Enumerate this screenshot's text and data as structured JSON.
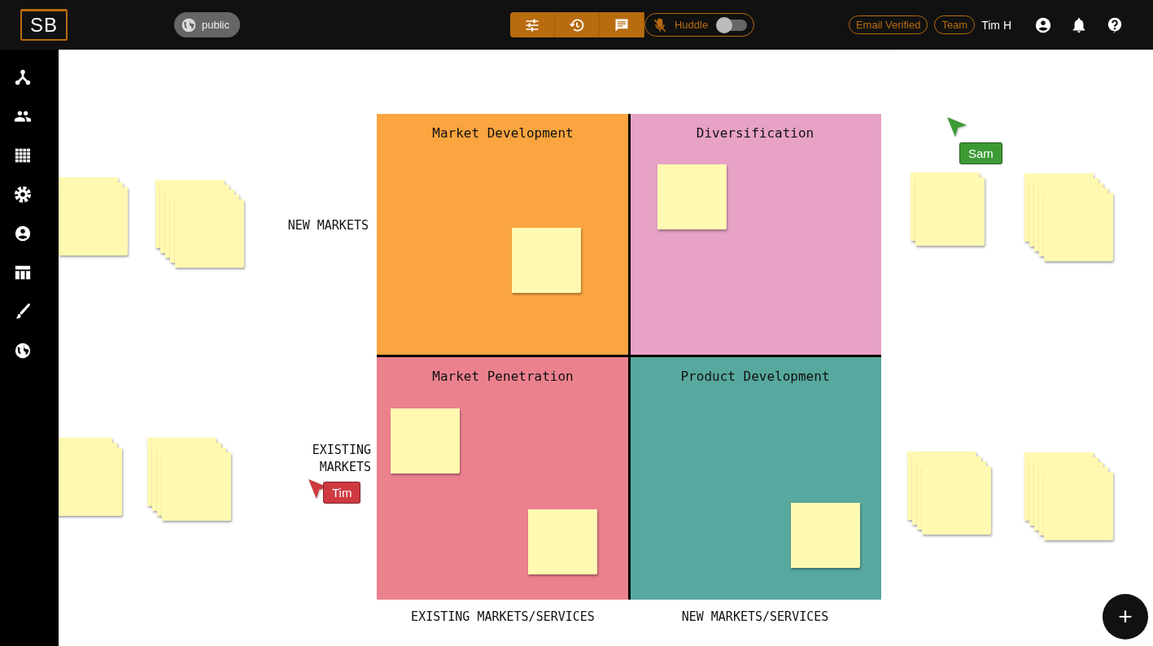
{
  "topbar": {
    "logo": "SB",
    "visibility": "public",
    "huddle": {
      "label": "Huddle",
      "on": false
    },
    "badges": [
      "Email Verified",
      "Team"
    ],
    "user": "Tim H"
  },
  "board": {
    "quadrants": [
      {
        "label": "Market Development",
        "color": "#fba540"
      },
      {
        "label": "Diversification",
        "color": "#e8a2c6"
      },
      {
        "label": "Market Penetration",
        "color": "#ec818e"
      },
      {
        "label": "Product Development",
        "color": "#57a89e"
      }
    ],
    "y_labels": [
      "NEW MARKETS",
      "EXISTING MARKETS"
    ],
    "x_labels": [
      "EXISTING MARKETS/SERVICES",
      "NEW MARKETS/SERVICES"
    ]
  },
  "cursors": [
    {
      "name": "Sam",
      "color": "#3c9a35"
    },
    {
      "name": "Tim",
      "color": "#cf3a41"
    }
  ],
  "fab": "+"
}
